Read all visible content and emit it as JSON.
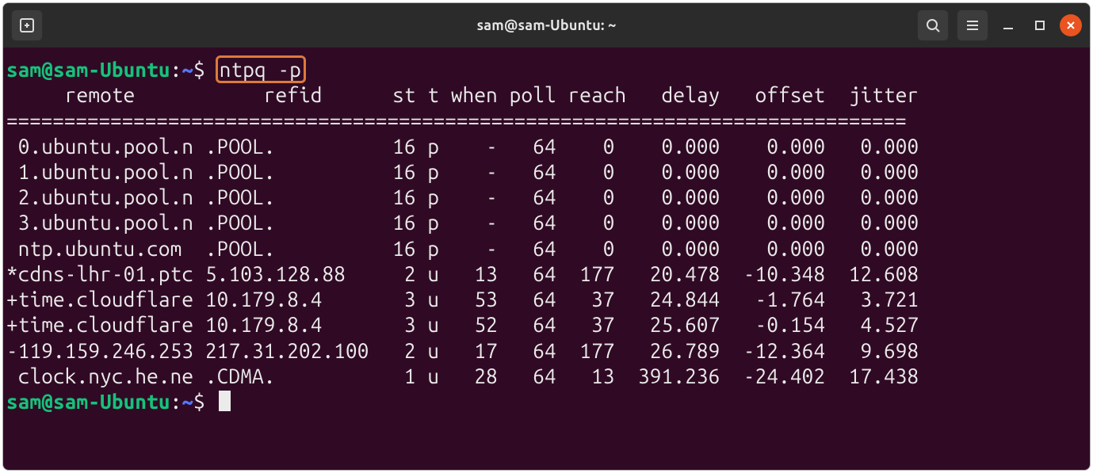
{
  "window": {
    "title": "sam@sam-Ubuntu: ~"
  },
  "prompt": {
    "user_host": "sam@sam-Ubuntu",
    "sep": ":",
    "path": "~",
    "dollar": "$"
  },
  "command": "ntpq -p",
  "header": "     remote           refid      st t when poll reach   delay   offset  jitter",
  "separator": "==============================================================================",
  "rows": [
    {
      "remote": " 0.ubuntu.pool.n",
      "refid": ".POOL.",
      "st": "16",
      "t": "p",
      "when": "-",
      "poll": "64",
      "reach": "0",
      "delay": "0.000",
      "offset": "0.000",
      "jitter": "0.000"
    },
    {
      "remote": " 1.ubuntu.pool.n",
      "refid": ".POOL.",
      "st": "16",
      "t": "p",
      "when": "-",
      "poll": "64",
      "reach": "0",
      "delay": "0.000",
      "offset": "0.000",
      "jitter": "0.000"
    },
    {
      "remote": " 2.ubuntu.pool.n",
      "refid": ".POOL.",
      "st": "16",
      "t": "p",
      "when": "-",
      "poll": "64",
      "reach": "0",
      "delay": "0.000",
      "offset": "0.000",
      "jitter": "0.000"
    },
    {
      "remote": " 3.ubuntu.pool.n",
      "refid": ".POOL.",
      "st": "16",
      "t": "p",
      "when": "-",
      "poll": "64",
      "reach": "0",
      "delay": "0.000",
      "offset": "0.000",
      "jitter": "0.000"
    },
    {
      "remote": " ntp.ubuntu.com",
      "refid": ".POOL.",
      "st": "16",
      "t": "p",
      "when": "-",
      "poll": "64",
      "reach": "0",
      "delay": "0.000",
      "offset": "0.000",
      "jitter": "0.000"
    },
    {
      "remote": "*cdns-lhr-01.ptc",
      "refid": "5.103.128.88",
      "st": "2",
      "t": "u",
      "when": "13",
      "poll": "64",
      "reach": "177",
      "delay": "20.478",
      "offset": "-10.348",
      "jitter": "12.608"
    },
    {
      "remote": "+time.cloudflare",
      "refid": "10.179.8.4",
      "st": "3",
      "t": "u",
      "when": "53",
      "poll": "64",
      "reach": "37",
      "delay": "24.844",
      "offset": "-1.764",
      "jitter": "3.721"
    },
    {
      "remote": "+time.cloudflare",
      "refid": "10.179.8.4",
      "st": "3",
      "t": "u",
      "when": "52",
      "poll": "64",
      "reach": "37",
      "delay": "25.607",
      "offset": "-0.154",
      "jitter": "4.527"
    },
    {
      "remote": "-119.159.246.253",
      "refid": "217.31.202.100",
      "st": "2",
      "t": "u",
      "when": "17",
      "poll": "64",
      "reach": "177",
      "delay": "26.789",
      "offset": "-12.364",
      "jitter": "9.698"
    },
    {
      "remote": " clock.nyc.he.ne",
      "refid": ".CDMA.",
      "st": "1",
      "t": "u",
      "when": "28",
      "poll": "64",
      "reach": "13",
      "delay": "391.236",
      "offset": "-24.402",
      "jitter": "17.438"
    }
  ],
  "icons": {
    "newtab": "new-tab-icon",
    "search": "search-icon",
    "hamburger": "hamburger-icon",
    "minimize": "minimize-icon",
    "maximize": "maximize-icon",
    "close": "close-icon"
  }
}
